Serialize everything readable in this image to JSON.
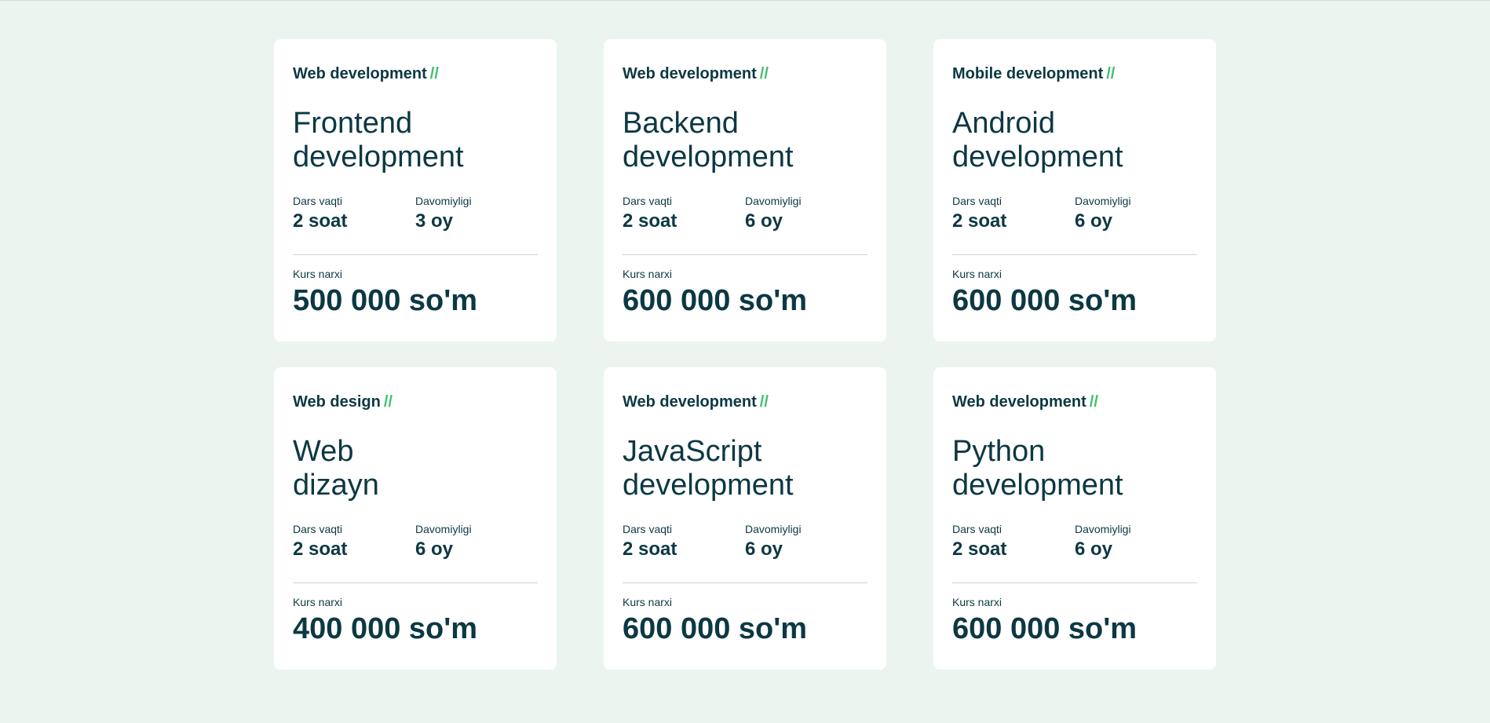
{
  "labels": {
    "lesson_time": "Dars vaqti",
    "duration": "Davomiyligi",
    "price": "Kurs narxi",
    "separator": "//"
  },
  "colors": {
    "background": "#ecf4ef",
    "card": "#ffffff",
    "text": "#0c3843",
    "accent": "#3fbf6e"
  },
  "courses": [
    {
      "category": "Web development",
      "title": "Frontend development",
      "lesson_time": "2 soat",
      "duration": "3 oy",
      "price": "500 000 so'm"
    },
    {
      "category": "Web development",
      "title": "Backend development",
      "lesson_time": "2 soat",
      "duration": "6 oy",
      "price": "600 000 so'm"
    },
    {
      "category": "Mobile development",
      "title": "Android development",
      "lesson_time": "2 soat",
      "duration": "6 oy",
      "price": "600 000 so'm"
    },
    {
      "category": "Web design",
      "title": "Web dizayn",
      "lesson_time": "2 soat",
      "duration": "6 oy",
      "price": "400 000 so'm"
    },
    {
      "category": "Web development",
      "title": "JavaScript development",
      "lesson_time": "2 soat",
      "duration": "6 oy",
      "price": "600 000 so'm"
    },
    {
      "category": "Web development",
      "title": "Python development",
      "lesson_time": "2 soat",
      "duration": "6 oy",
      "price": "600 000 so'm"
    }
  ]
}
